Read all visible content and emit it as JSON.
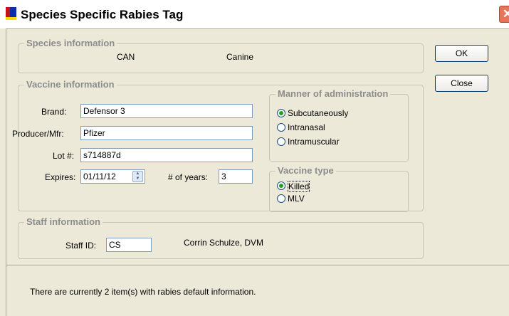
{
  "window": {
    "title": "Species Specific Rabies Tag",
    "close_glyph": "✕"
  },
  "buttons": {
    "ok": "OK",
    "close": "Close"
  },
  "species": {
    "group_title": "Species information",
    "code": "CAN",
    "name": "Canine"
  },
  "vaccine": {
    "group_title": "Vaccine information",
    "brand_label": "Brand:",
    "brand_value": "Defensor 3",
    "producer_label": "Producer/Mfr:",
    "producer_value": "Pfizer",
    "lot_label": "Lot #:",
    "lot_value": "s714887d",
    "expires_label": "Expires:",
    "expires_value": "01/11/12",
    "years_label": "# of years:",
    "years_value": "3"
  },
  "administration": {
    "group_title": "Manner of administration",
    "options": [
      {
        "label": "Subcutaneously",
        "selected": true
      },
      {
        "label": "Intranasal",
        "selected": false
      },
      {
        "label": "Intramuscular",
        "selected": false
      }
    ]
  },
  "vaccine_type": {
    "group_title": "Vaccine type",
    "options": [
      {
        "label": "Killed",
        "selected": true
      },
      {
        "label": "MLV",
        "selected": false
      }
    ]
  },
  "staff": {
    "group_title": "Staff information",
    "id_label": "Staff ID:",
    "id_value": "CS",
    "name": "Corrin  Schulze, DVM"
  },
  "status_text": "There are currently 2 item(s) with rabies default information.",
  "colors": {
    "title_icon_blue": "#0b2fa8",
    "title_icon_yellow": "#ffd800",
    "radio_selected": "#21a121"
  }
}
